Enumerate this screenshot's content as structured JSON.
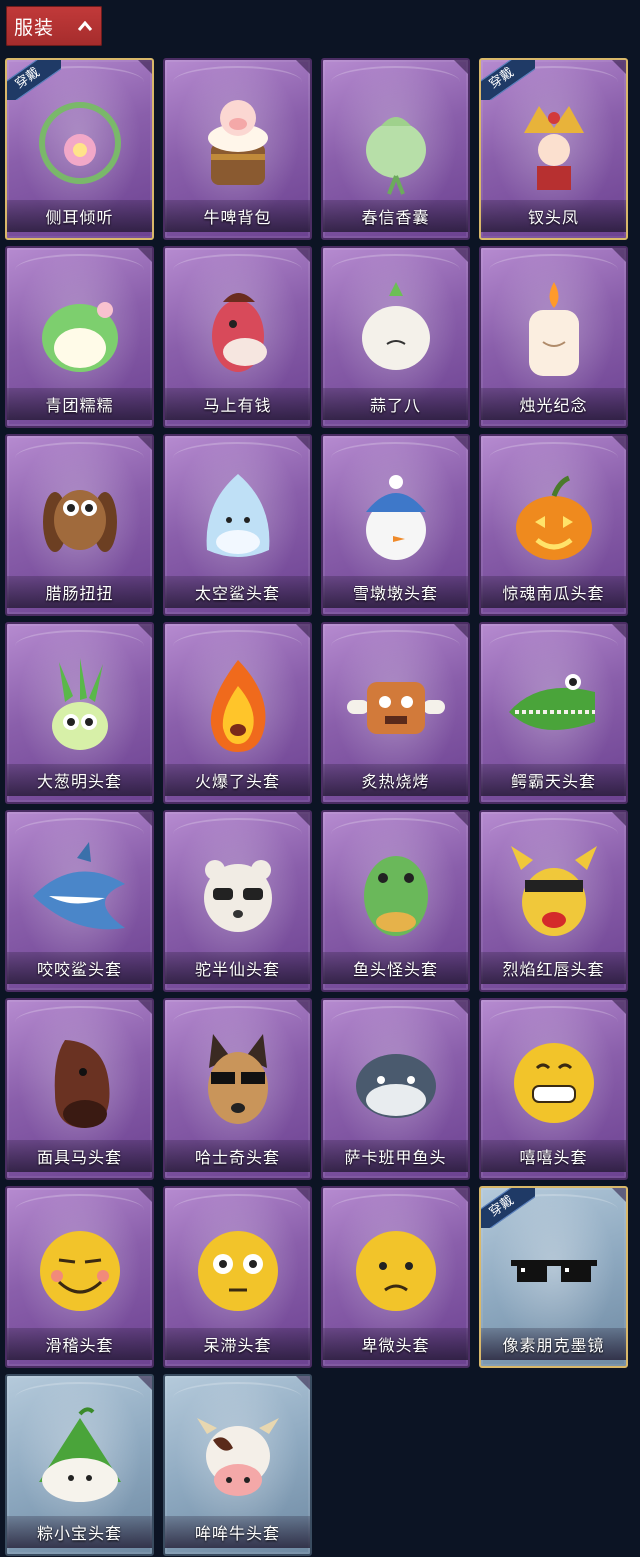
{
  "header": {
    "title": "服装"
  },
  "worn_label": "穿戴",
  "items": [
    {
      "name": "侧耳倾听",
      "icon": "flower-wreath-icon",
      "bg": "purple",
      "worn": true
    },
    {
      "name": "牛啤背包",
      "icon": "beer-barrel-cow-icon",
      "bg": "purple",
      "worn": false
    },
    {
      "name": "春信香囊",
      "icon": "sachet-icon",
      "bg": "purple",
      "worn": false
    },
    {
      "name": "钗头凤",
      "icon": "phoenix-crown-icon",
      "bg": "purple",
      "worn": true
    },
    {
      "name": "青团糯糯",
      "icon": "green-rice-ball-icon",
      "bg": "purple",
      "worn": false
    },
    {
      "name": "马上有钱",
      "icon": "pink-horse-icon",
      "bg": "purple",
      "worn": false
    },
    {
      "name": "蒜了八",
      "icon": "garlic-icon",
      "bg": "purple",
      "worn": false
    },
    {
      "name": "烛光纪念",
      "icon": "candle-icon",
      "bg": "purple",
      "worn": false
    },
    {
      "name": "腊肠扭扭",
      "icon": "dog-head-icon",
      "bg": "purple",
      "worn": false
    },
    {
      "name": "太空鲨头套",
      "icon": "space-shark-icon",
      "bg": "purple",
      "worn": false
    },
    {
      "name": "雪墩墩头套",
      "icon": "snowman-icon",
      "bg": "purple",
      "worn": false
    },
    {
      "name": "惊魂南瓜头套",
      "icon": "pumpkin-icon",
      "bg": "purple",
      "worn": false
    },
    {
      "name": "大葱明头套",
      "icon": "green-onion-icon",
      "bg": "purple",
      "worn": false
    },
    {
      "name": "火爆了头套",
      "icon": "fire-icon",
      "bg": "purple",
      "worn": false
    },
    {
      "name": "炙热烧烤",
      "icon": "meat-bone-icon",
      "bg": "purple",
      "worn": false
    },
    {
      "name": "鳄霸天头套",
      "icon": "crocodile-icon",
      "bg": "purple",
      "worn": false
    },
    {
      "name": "咬咬鲨头套",
      "icon": "shark-icon",
      "bg": "purple",
      "worn": false
    },
    {
      "name": "驼半仙头套",
      "icon": "bear-sunglasses-icon",
      "bg": "purple",
      "worn": false
    },
    {
      "name": "鱼头怪头套",
      "icon": "fish-head-icon",
      "bg": "purple",
      "worn": false
    },
    {
      "name": "烈焰红唇头套",
      "icon": "yellow-creature-icon",
      "bg": "purple",
      "worn": false
    },
    {
      "name": "面具马头套",
      "icon": "horse-mask-icon",
      "bg": "purple",
      "worn": false
    },
    {
      "name": "哈士奇头套",
      "icon": "husky-icon",
      "bg": "purple",
      "worn": false
    },
    {
      "name": "萨卡班甲鱼头",
      "icon": "fish-blob-icon",
      "bg": "purple",
      "worn": false
    },
    {
      "name": "嘻嘻头套",
      "icon": "grin-emoji-icon",
      "bg": "purple",
      "worn": false
    },
    {
      "name": "滑稽头套",
      "icon": "smirk-emoji-icon",
      "bg": "purple",
      "worn": false
    },
    {
      "name": "呆滞头套",
      "icon": "dazed-emoji-icon",
      "bg": "purple",
      "worn": false
    },
    {
      "name": "卑微头套",
      "icon": "humble-emoji-icon",
      "bg": "purple",
      "worn": false
    },
    {
      "name": "像素朋克墨镜",
      "icon": "pixel-sunglasses-icon",
      "bg": "blue",
      "worn": true
    },
    {
      "name": "粽小宝头套",
      "icon": "zongzi-icon",
      "bg": "blue",
      "worn": false
    },
    {
      "name": "哞哞牛头套",
      "icon": "cow-head-icon",
      "bg": "blue",
      "worn": false
    }
  ]
}
